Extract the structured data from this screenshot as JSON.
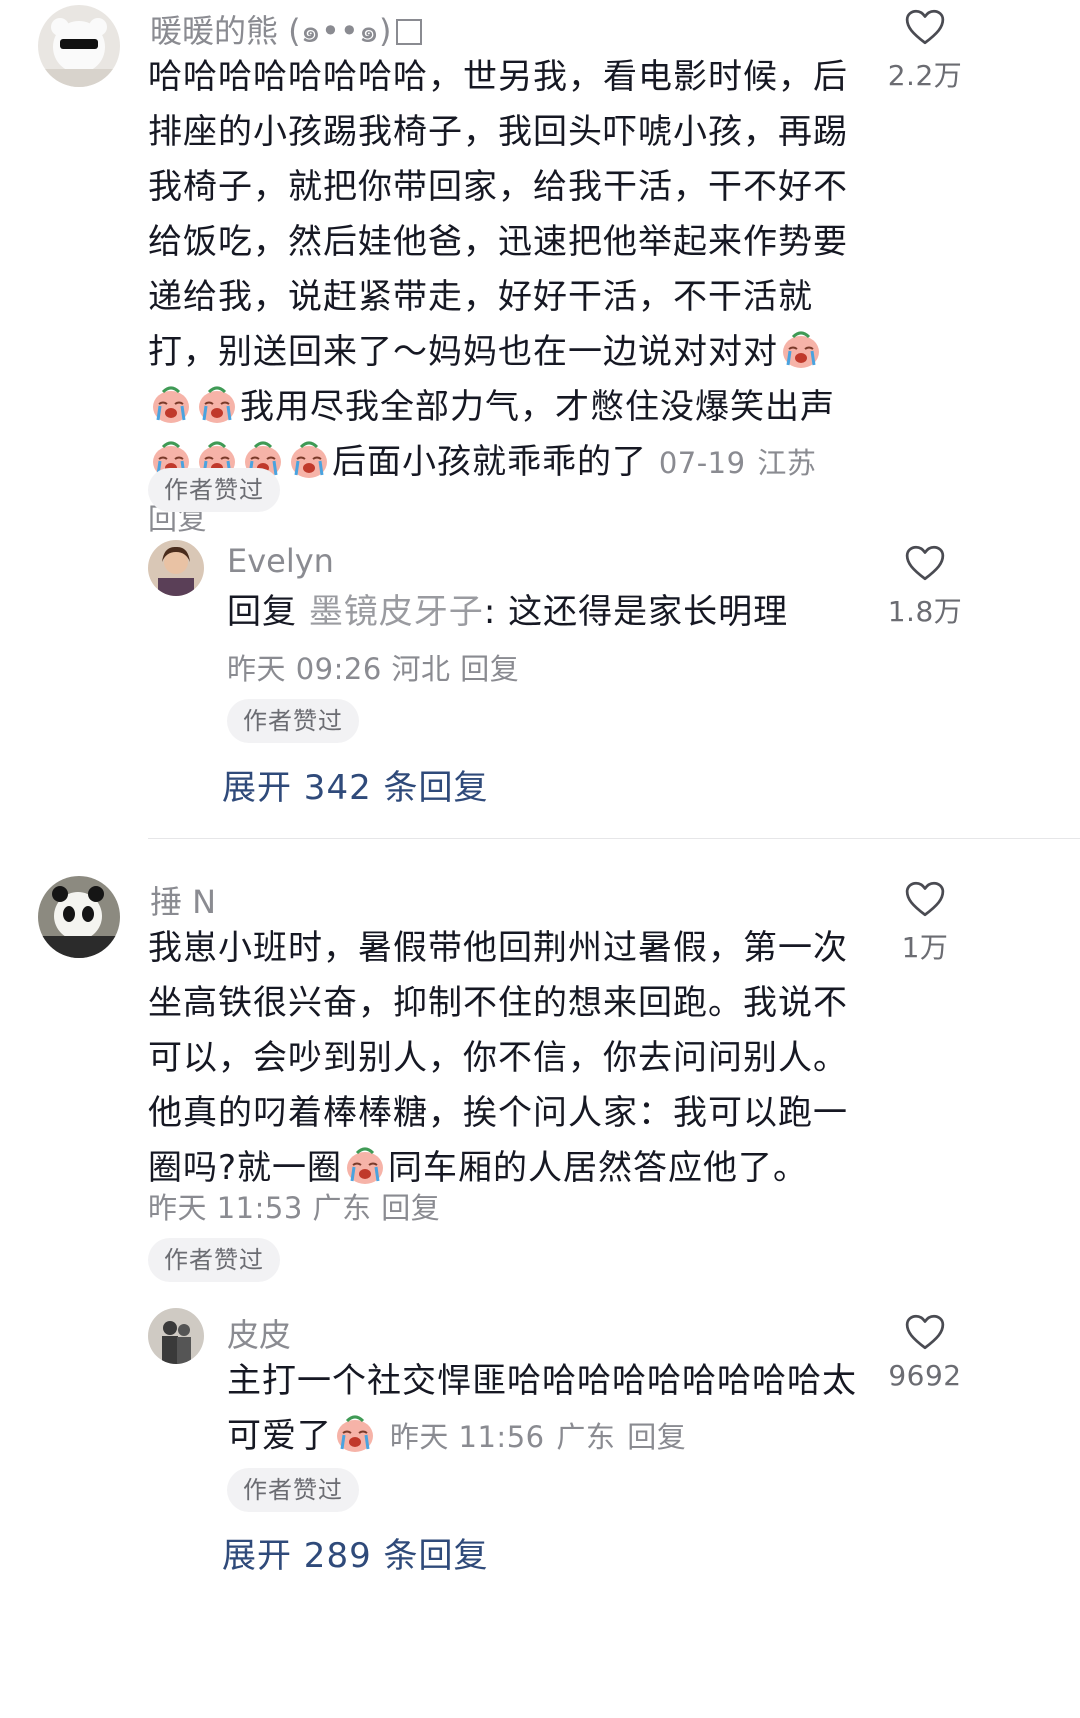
{
  "comments": [
    {
      "user": "暖暖的熊 (๑••๑)",
      "avatar_icon": "bear-with-sunglasses-avatar",
      "text_parts": [
        "哈哈哈哈哈哈哈哈，世另我，看电影时候，后排座的小孩踢我椅子，我回头吓唬小孩，再踢我椅子，就把你带回家，给我干活，干不好不给饭吃，然后娃他爸，迅速把他举起来作势要递给我，说赶紧带走，好好干活，不干活就打，别送回来了～妈妈也在一边说对对对",
        "我用尽我全部力气，才憋住没爆笑出声",
        "后面小孩就乖乖的了"
      ],
      "date": "07-19",
      "location": "江苏",
      "reply_label": "回复",
      "badge": "作者赞过",
      "likes": "2.2万",
      "replies": [
        {
          "user": "Evelyn",
          "avatar_icon": "woman-portrait-avatar",
          "reply_prefix": "回复",
          "reply_to": "墨镜皮牙子",
          "text": ": 这还得是家长明理",
          "date": "昨天 09:26",
          "location": "河北",
          "reply_label": "回复",
          "badge": "作者赞过",
          "likes": "1.8万"
        }
      ],
      "expand_label": "展开 342 条回复"
    },
    {
      "user": "捶 N",
      "avatar_icon": "panda-avatar",
      "text_parts": [
        "我崽小班时，暑假带他回荆州过暑假，第一次坐高铁很兴奋，抑制不住的想来回跑。我说不可以，会吵到别人，你不信，你去问问别人。他真的叼着棒棒糖，挨个问人家：我可以跑一圈吗?就一圈",
        "同车厢的人居然答应他了。"
      ],
      "date": "昨天 11:53",
      "location": "广东",
      "reply_label": "回复",
      "badge": "作者赞过",
      "likes": "1万",
      "replies": [
        {
          "user": "皮皮",
          "avatar_icon": "couple-photo-avatar",
          "text": "主打一个社交悍匪哈哈哈哈哈哈哈哈哈太可爱了",
          "date": "昨天 11:56",
          "location": "广东",
          "reply_label": "回复",
          "badge": "作者赞过",
          "likes": "9692"
        }
      ],
      "expand_label": "展开 289 条回复"
    }
  ],
  "colors": {
    "text": "#161823",
    "meta": "#8a8b91",
    "expand_link": "#2f4a7a",
    "badge_bg": "#f2f2f4"
  }
}
